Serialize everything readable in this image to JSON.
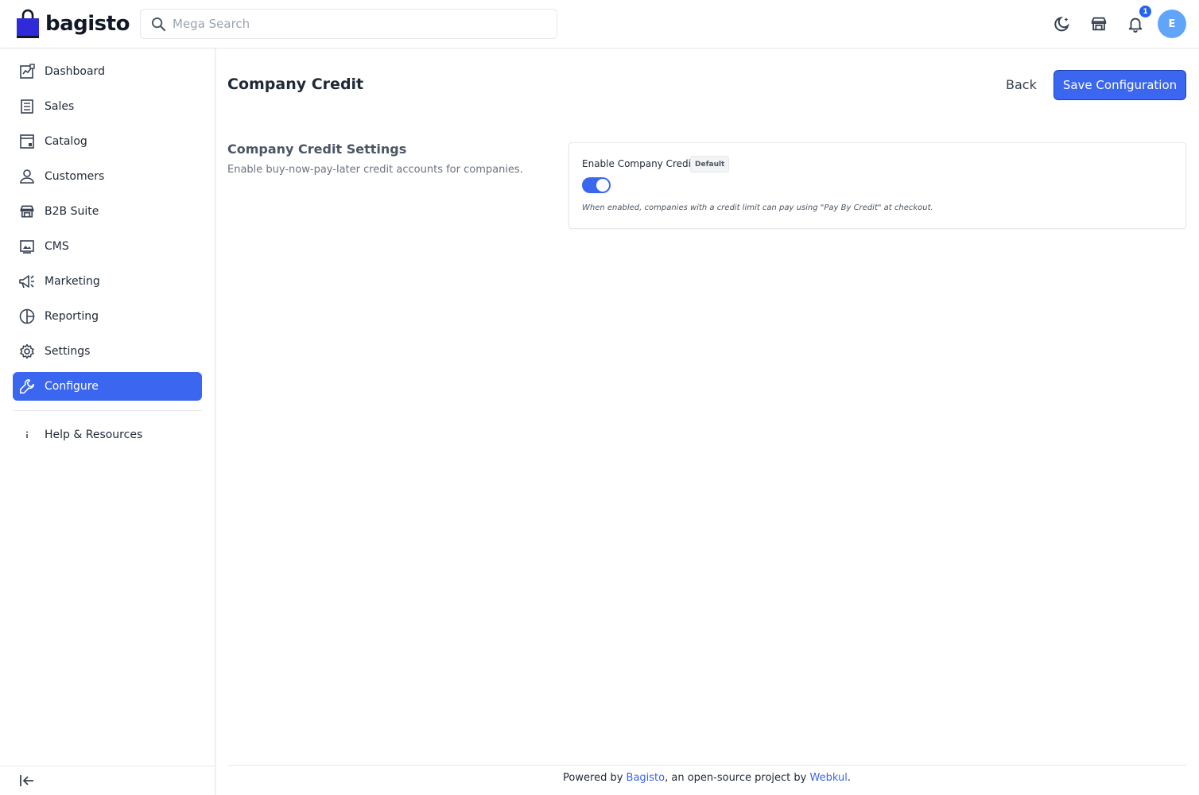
{
  "brand": {
    "name": "bagisto",
    "color": "#3b66f0"
  },
  "header": {
    "search_placeholder": "Mega Search",
    "notifications_count": "1",
    "avatar_initial": "E"
  },
  "sidebar": {
    "items": [
      {
        "label": "Dashboard",
        "icon": "dashboard-icon"
      },
      {
        "label": "Sales",
        "icon": "sales-icon"
      },
      {
        "label": "Catalog",
        "icon": "catalog-icon"
      },
      {
        "label": "Customers",
        "icon": "customers-icon"
      },
      {
        "label": "B2B Suite",
        "icon": "store-icon"
      },
      {
        "label": "CMS",
        "icon": "cms-icon"
      },
      {
        "label": "Marketing",
        "icon": "megaphone-icon"
      },
      {
        "label": "Reporting",
        "icon": "pie-chart-icon"
      },
      {
        "label": "Settings",
        "icon": "gear-icon"
      },
      {
        "label": "Configure",
        "icon": "wrench-icon",
        "active": true
      }
    ],
    "help": {
      "label": "Help & Resources",
      "icon": "info-icon"
    }
  },
  "main": {
    "title": "Company Credit",
    "back_label": "Back",
    "save_label": "Save Configuration",
    "section": {
      "title": "Company Credit Settings",
      "description": "Enable buy-now-pay-later credit accounts for companies."
    },
    "field": {
      "label": "Enable Company Credit",
      "chip": "Default",
      "enabled": true,
      "help": "When enabled, companies with a credit limit can pay using \"Pay By Credit\" at checkout."
    }
  },
  "footer": {
    "prefix": "Powered by ",
    "link1": "Bagisto",
    "middle": ", an open-source project by ",
    "link2": "Webkul",
    "suffix": "."
  }
}
